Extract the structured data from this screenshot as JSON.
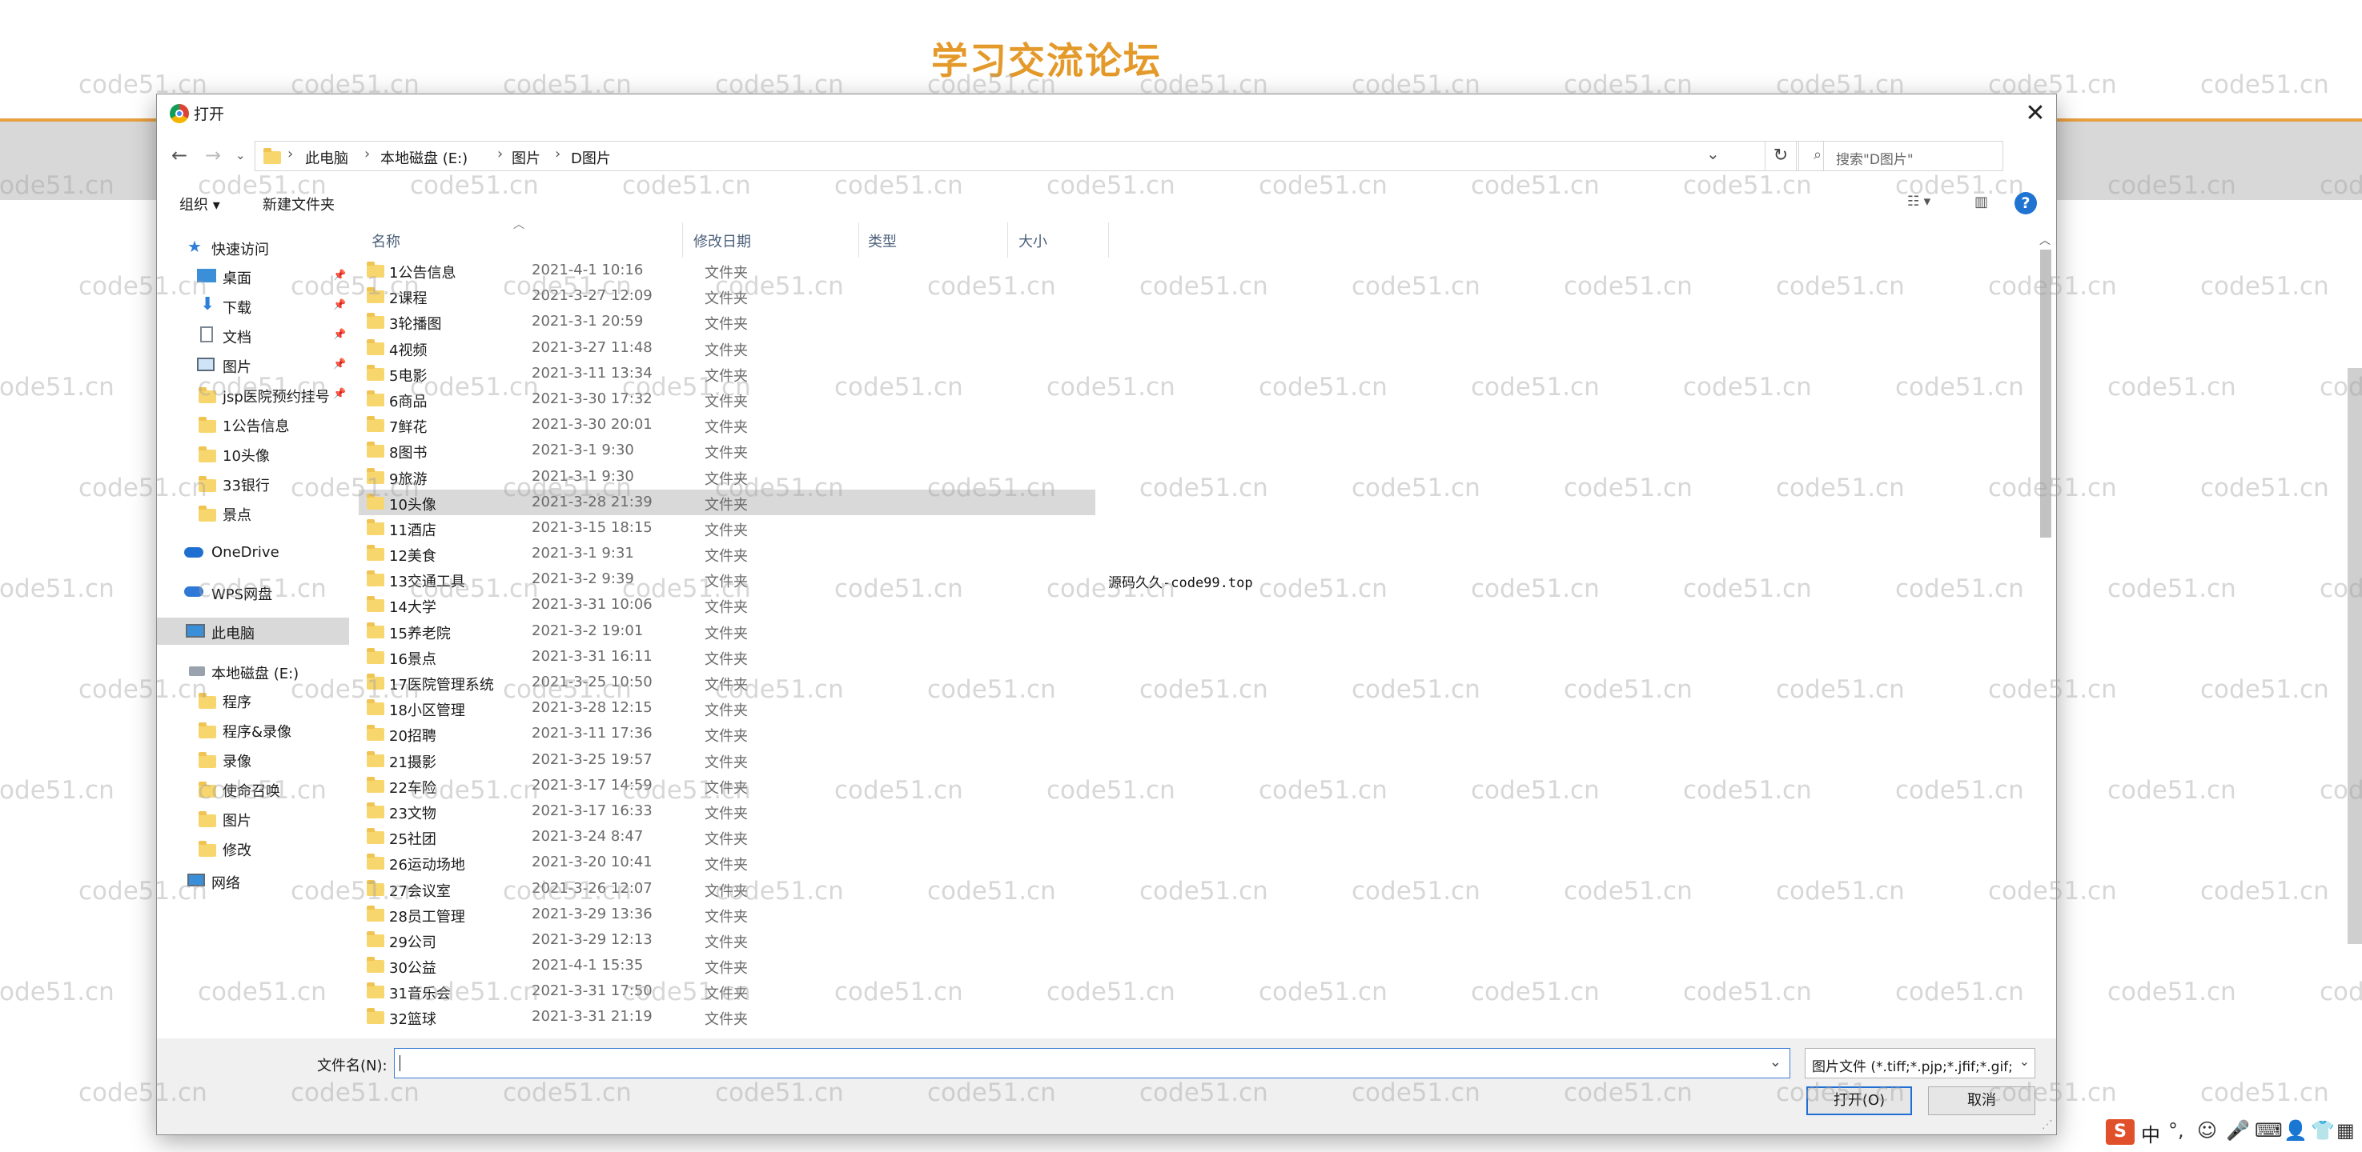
{
  "page": {
    "site_title": "学习交流论坛",
    "watermark": "code51.cn"
  },
  "dialog": {
    "title": "打开",
    "close_label": "✕",
    "breadcrumbs": [
      "此电脑",
      "本地磁盘 (E:)",
      "图片",
      "D图片"
    ],
    "search_placeholder": "搜索\"D图片\"",
    "toolbar": {
      "organize": "组织 ▾",
      "new_folder": "新建文件夹"
    },
    "sidebar": {
      "quick_access": "快速访问",
      "quick_items": [
        "桌面",
        "下载",
        "文档",
        "图片",
        "jsp医院预约挂号",
        "1公告信息",
        "10头像",
        "33银行",
        "景点"
      ],
      "onedrive": "OneDrive",
      "wps": "WPS网盘",
      "this_pc": "此电脑",
      "disk": "本地磁盘 (E:)",
      "disk_items": [
        "程序",
        "程序&录像",
        "录像",
        "使命召唤",
        "图片",
        "修改"
      ],
      "network": "网络"
    },
    "columns": {
      "name": "名称",
      "date": "修改日期",
      "type": "类型",
      "size": "大小"
    },
    "files": [
      {
        "name": "1公告信息",
        "date": "2021-4-1 10:16",
        "type": "文件夹"
      },
      {
        "name": "2课程",
        "date": "2021-3-27 12:09",
        "type": "文件夹"
      },
      {
        "name": "3轮播图",
        "date": "2021-3-1 20:59",
        "type": "文件夹"
      },
      {
        "name": "4视频",
        "date": "2021-3-27 11:48",
        "type": "文件夹"
      },
      {
        "name": "5电影",
        "date": "2021-3-11 13:34",
        "type": "文件夹"
      },
      {
        "name": "6商品",
        "date": "2021-3-30 17:32",
        "type": "文件夹"
      },
      {
        "name": "7鲜花",
        "date": "2021-3-30 20:01",
        "type": "文件夹"
      },
      {
        "name": "8图书",
        "date": "2021-3-1 9:30",
        "type": "文件夹"
      },
      {
        "name": "9旅游",
        "date": "2021-3-1 9:30",
        "type": "文件夹"
      },
      {
        "name": "10头像",
        "date": "2021-3-28 21:39",
        "type": "文件夹"
      },
      {
        "name": "11酒店",
        "date": "2021-3-15 18:15",
        "type": "文件夹"
      },
      {
        "name": "12美食",
        "date": "2021-3-1 9:31",
        "type": "文件夹"
      },
      {
        "name": "13交通工具",
        "date": "2021-3-2 9:39",
        "type": "文件夹"
      },
      {
        "name": "14大学",
        "date": "2021-3-31 10:06",
        "type": "文件夹"
      },
      {
        "name": "15养老院",
        "date": "2021-3-2 19:01",
        "type": "文件夹"
      },
      {
        "name": "16景点",
        "date": "2021-3-31 16:11",
        "type": "文件夹"
      },
      {
        "name": "17医院管理系统",
        "date": "2021-3-25 10:50",
        "type": "文件夹"
      },
      {
        "name": "18小区管理",
        "date": "2021-3-28 12:15",
        "type": "文件夹"
      },
      {
        "name": "20招聘",
        "date": "2021-3-11 17:36",
        "type": "文件夹"
      },
      {
        "name": "21摄影",
        "date": "2021-3-25 19:57",
        "type": "文件夹"
      },
      {
        "name": "22车险",
        "date": "2021-3-17 14:59",
        "type": "文件夹"
      },
      {
        "name": "23文物",
        "date": "2021-3-17 16:33",
        "type": "文件夹"
      },
      {
        "name": "25社团",
        "date": "2021-3-24 8:47",
        "type": "文件夹"
      },
      {
        "name": "26运动场地",
        "date": "2021-3-20 10:41",
        "type": "文件夹"
      },
      {
        "name": "27会议室",
        "date": "2021-3-26 12:07",
        "type": "文件夹"
      },
      {
        "name": "28员工管理",
        "date": "2021-3-29 13:36",
        "type": "文件夹"
      },
      {
        "name": "29公司",
        "date": "2021-3-29 12:13",
        "type": "文件夹"
      },
      {
        "name": "30公益",
        "date": "2021-4-1 15:35",
        "type": "文件夹"
      },
      {
        "name": "31音乐会",
        "date": "2021-3-31 17:50",
        "type": "文件夹"
      },
      {
        "name": "32篮球",
        "date": "2021-3-31 21:19",
        "type": "文件夹"
      }
    ],
    "note": "源码久久-code99.top",
    "filename_label": "文件名(N):",
    "filename_value": "",
    "filter_text": "图片文件 (*.tiff;*.pjp;*.jfif;*.gif;",
    "open_button": "打开(O)",
    "cancel_button": "取消"
  },
  "tray": {
    "ime": "中"
  }
}
